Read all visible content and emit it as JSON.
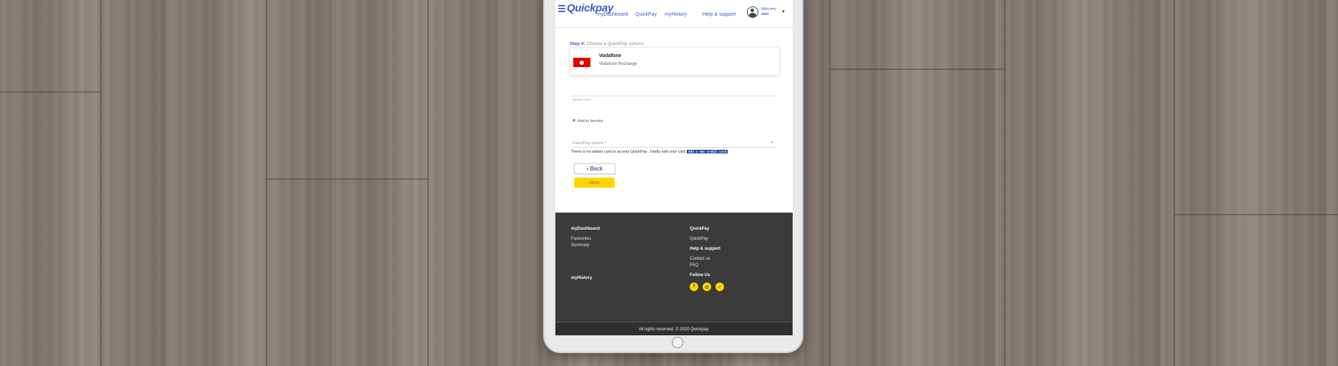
{
  "nav": {
    "logo": "Quickpay",
    "links": [
      "myDashboard",
      "QuickPay",
      "myHistory",
      "Help & support"
    ],
    "welcome": "Welcome",
    "user": "user"
  },
  "form": {
    "step_label": "Step 4:",
    "step_text": "Choose a QuickPay options",
    "provider": {
      "name": "Vodafone",
      "service": "Vodafone Recharge"
    },
    "service_field_label": "Service Item *",
    "favorite_label": "Add to favorite",
    "options_placeholder": "FawryPay options *",
    "no_card_note": "There is no added card to access QuickPay , kindly add your card",
    "add_card_label": "Add a new credit card",
    "back_label": "Back",
    "next_label": "Next"
  },
  "footer": {
    "col1": {
      "heading": "myDashboard",
      "links": [
        "Favourites",
        "Summary"
      ],
      "heading2": "myHistory"
    },
    "col2": {
      "heading": "QuickPay",
      "link": "QuickPay",
      "help_heading": "Help & support",
      "help_links": [
        "Contact us",
        "FAQ"
      ],
      "follow_heading": "Follow Us"
    },
    "social_icons": [
      "facebook-icon",
      "instagram-icon",
      "twitter-icon"
    ],
    "social_color": "#ffd400",
    "copyright": "All rights reserved. © 2020 Quickpay."
  },
  "colors": {
    "brand": "#3c5bc5",
    "next_button": "#ffd400",
    "footer_bg": "#3b3b3b",
    "vodafone": "#e60000"
  }
}
